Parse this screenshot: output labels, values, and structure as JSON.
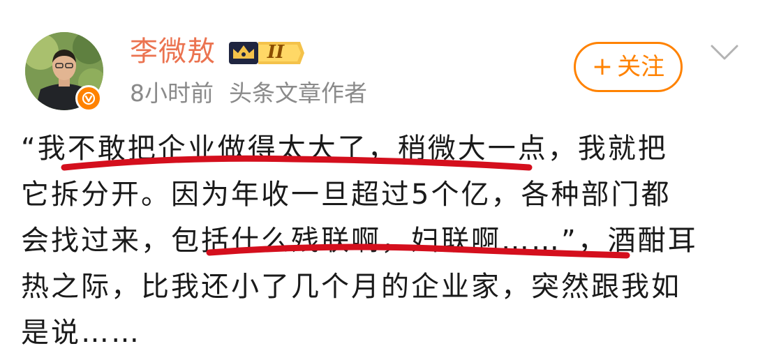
{
  "post": {
    "author": "李微敖",
    "level": "II",
    "time": "8小时前",
    "source": "头条文章作者",
    "follow_plus": "+",
    "follow_label": "关注",
    "body_lines": [
      "“我不敢把企业做得太大了，稍微大一点，我就把",
      "它拆分开。因为年收一旦超过5个亿，各种部门都",
      "会找过来，包括什么残联啊，妇联啊……”，酒酣耳",
      "热之际，比我还小了几个月的企业家，突然跟我如",
      "是说……"
    ]
  },
  "icons": {
    "avatar": "avatar-photo",
    "verified": "verified-v-icon",
    "level": "crown-level-icon",
    "more": "chevron-down-icon"
  },
  "colors": {
    "author_name": "#eb7350",
    "follow_accent": "#ff8200",
    "meta_text": "#8a8a8a",
    "marker": "#d40f1d"
  }
}
